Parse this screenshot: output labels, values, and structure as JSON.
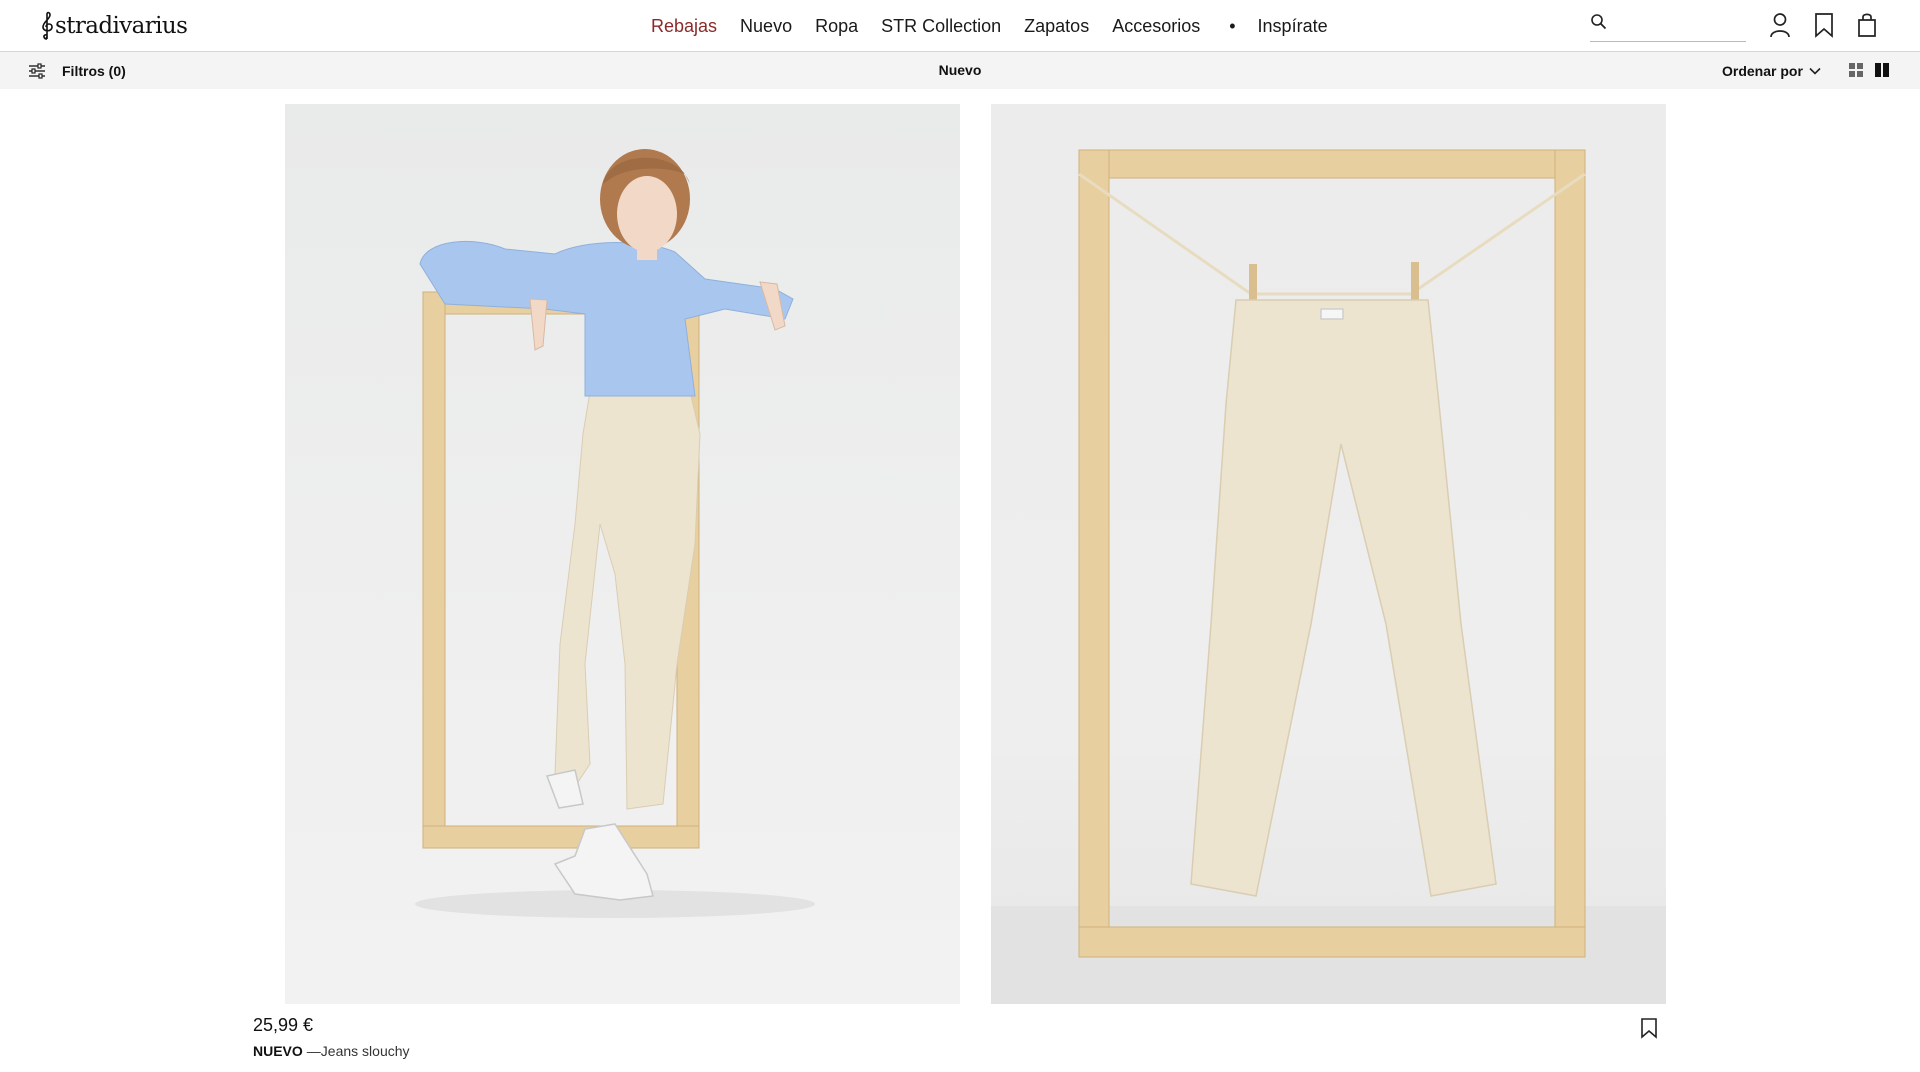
{
  "header": {
    "logo_text": "stradivarius",
    "nav": [
      {
        "label": "Rebajas",
        "active": true
      },
      {
        "label": "Nuevo",
        "active": false
      },
      {
        "label": "Ropa",
        "active": false
      },
      {
        "label": "STR Collection",
        "active": false
      },
      {
        "label": "Zapatos",
        "active": false
      },
      {
        "label": "Accesorios",
        "active": false
      },
      {
        "label": "•",
        "active": false
      },
      {
        "label": "Inspírate",
        "active": false
      }
    ],
    "search_value": "",
    "icons": [
      "search-icon",
      "user-icon",
      "bookmark-icon",
      "shopping-bag-icon"
    ]
  },
  "filterbar": {
    "filters_label": "Filtros (0)",
    "section_title": "Nuevo",
    "sort_label": "Ordenar por",
    "view_options": [
      "grid-four-icon",
      "grid-two-icon"
    ]
  },
  "product": {
    "price": "25,99 €",
    "tag": "NUEVO",
    "name": "—Jeans slouchy"
  },
  "colors": {
    "accent_active_nav": "#8a2a2a",
    "wood_frame": "#e8cf9f",
    "shirt_blue": "#a9c6ee",
    "jeans_ecru": "#ede4d0"
  }
}
